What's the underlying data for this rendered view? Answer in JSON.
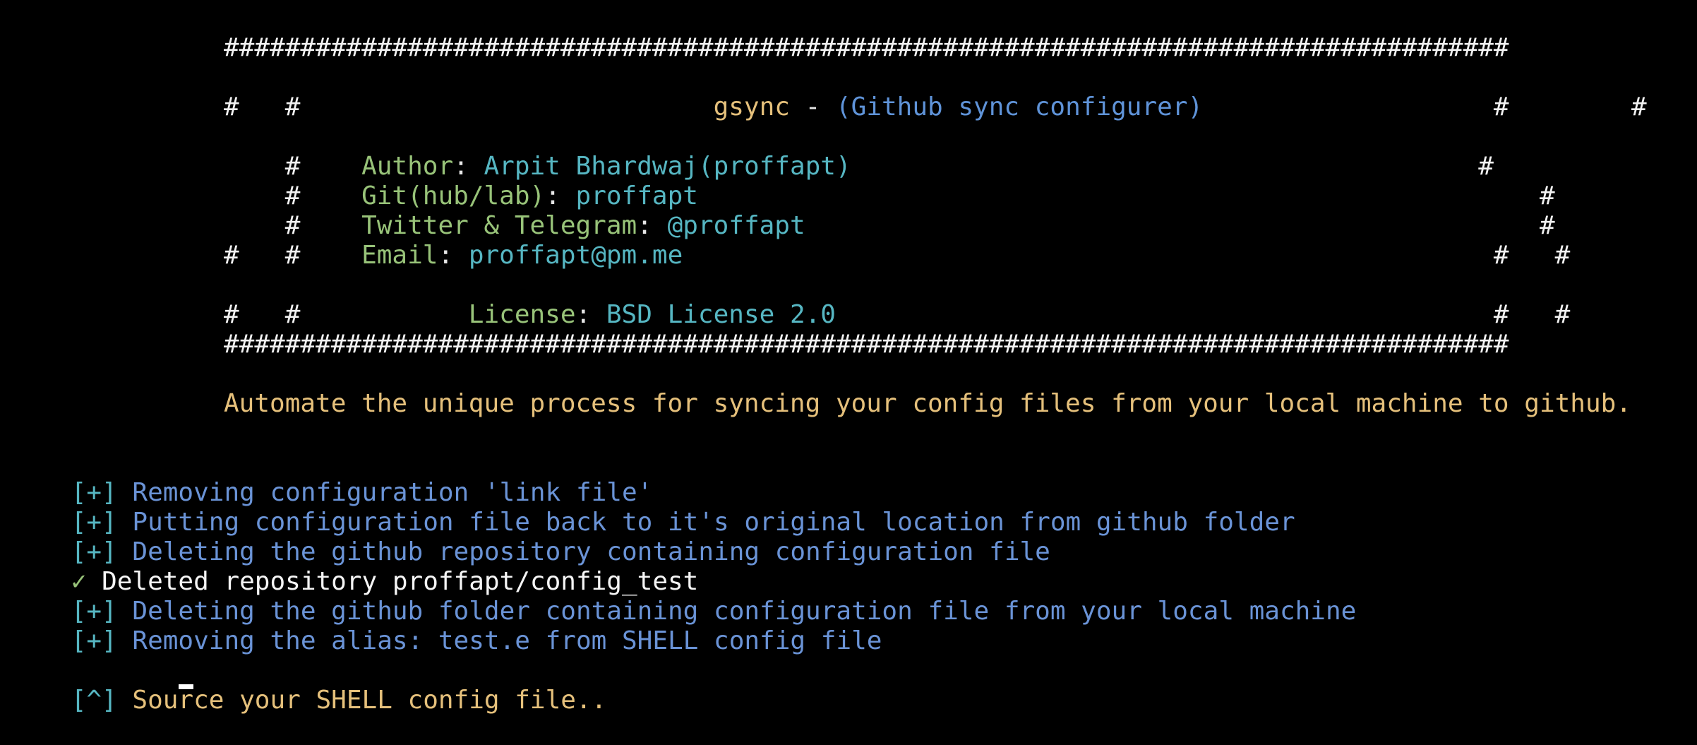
{
  "banner": {
    "border": "####################################################################################",
    "row_pad": "#                                                                                  #",
    "title_row": {
      "left": "#                           ",
      "app": "gsync",
      "dash": " - ",
      "subtitle": "(Github sync configurer)",
      "right": "                            #"
    },
    "author": {
      "lead": "#    ",
      "label": "Author",
      "sep": ": ",
      "value": "Arpit Bhardwaj(proffapt)",
      "trail": "                                         #"
    },
    "git": {
      "lead": "#    ",
      "label": "Git(hub/lab)",
      "sep": ": ",
      "value": "proffapt",
      "trail": "                                                       #"
    },
    "social": {
      "lead": "#    ",
      "label": "Twitter & Telegram",
      "sep": ": ",
      "value": "@proffapt",
      "trail": "                                                #"
    },
    "email": {
      "lead": "#    ",
      "label": "Email",
      "sep": ": ",
      "value": "proffapt@pm.me",
      "trail": "                                                         #"
    },
    "license": {
      "lead": "#           ",
      "label": "License",
      "sep": ": ",
      "value": "BSD License 2.0",
      "trail": "                                               #"
    }
  },
  "tagline": "Automate the unique process for syncing your config files from your local machine to github.",
  "log": [
    {
      "marker": "[+]",
      "text": " Removing configuration 'link file'"
    },
    {
      "marker": "[+]",
      "text": " Putting configuration file back to it's original location from github folder"
    },
    {
      "marker": "[+]",
      "text": " Deleting the github repository containing configuration file"
    },
    {
      "marker": "✓",
      "text": " Deleted repository proffapt/config_test",
      "kind": "ok"
    },
    {
      "marker": "[+]",
      "text": " Deleting the github folder containing configuration file from your local machine"
    },
    {
      "marker": "[+]",
      "text": " Removing the alias: test.e from SHELL config file"
    }
  ],
  "prompt": {
    "marker": "[^]",
    "text": " Source your SHELL config file.."
  },
  "colors": {
    "background": "#000000",
    "title": "#e5c07b",
    "subtitle": "#5f93d8",
    "label": "#98c379",
    "value": "#56b6c2",
    "log": "#6a93d6"
  }
}
